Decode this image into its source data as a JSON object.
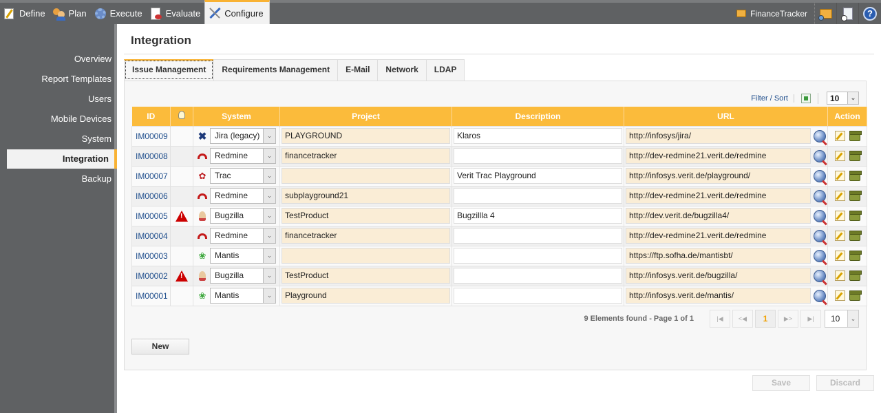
{
  "topnav": {
    "items": [
      {
        "label": "Define",
        "icon": "notepad-icon"
      },
      {
        "label": "Plan",
        "icon": "people-icon"
      },
      {
        "label": "Execute",
        "icon": "gear-icon"
      },
      {
        "label": "Evaluate",
        "icon": "report-chart-icon"
      },
      {
        "label": "Configure",
        "icon": "tools-icon",
        "active": true
      }
    ],
    "project": "FinanceTracker"
  },
  "sidebar": {
    "items": [
      {
        "label": "Overview"
      },
      {
        "label": "Report Templates"
      },
      {
        "label": "Users"
      },
      {
        "label": "Mobile Devices"
      },
      {
        "label": "System"
      },
      {
        "label": "Integration",
        "active": true
      },
      {
        "label": "Backup"
      }
    ]
  },
  "page": {
    "title": "Integration"
  },
  "tabs": [
    {
      "label": "Issue Management",
      "active": true
    },
    {
      "label": "Requirements Management"
    },
    {
      "label": "E-Mail"
    },
    {
      "label": "Network"
    },
    {
      "label": "LDAP"
    }
  ],
  "toolbar": {
    "filter_sort": "Filter / Sort",
    "page_size": "10"
  },
  "table": {
    "headers": {
      "id": "ID",
      "system": "System",
      "project": "Project",
      "description": "Description",
      "url": "URL",
      "action": "Action"
    },
    "rows": [
      {
        "id": "IM00009",
        "warning": false,
        "system": "Jira (legacy)",
        "system_icon": "jira-icon",
        "project": "PLAYGROUND",
        "description": "Klaros",
        "url": "http://infosys/jira/"
      },
      {
        "id": "IM00008",
        "warning": false,
        "system": "Redmine",
        "system_icon": "redmine-icon",
        "project": "financetracker",
        "description": "",
        "url": "http://dev-redmine21.verit.de/redmine"
      },
      {
        "id": "IM00007",
        "warning": false,
        "system": "Trac",
        "system_icon": "trac-icon",
        "project": "",
        "description": "Verit Trac Playground",
        "url": "http://infosys.verit.de/playground/"
      },
      {
        "id": "IM00006",
        "warning": false,
        "system": "Redmine",
        "system_icon": "redmine-icon",
        "project": "subplayground21",
        "description": "",
        "url": "http://dev-redmine21.verit.de/redmine"
      },
      {
        "id": "IM00005",
        "warning": true,
        "system": "Bugzilla",
        "system_icon": "bugzilla-icon",
        "project": "TestProduct",
        "description": "Bugzillla 4",
        "url": "http://dev.verit.de/bugzilla4/"
      },
      {
        "id": "IM00004",
        "warning": false,
        "system": "Redmine",
        "system_icon": "redmine-icon",
        "project": "financetracker",
        "description": "",
        "url": "http://dev-redmine21.verit.de/redmine"
      },
      {
        "id": "IM00003",
        "warning": false,
        "system": "Mantis",
        "system_icon": "mantis-icon",
        "project": "",
        "description": "",
        "url": "https://ftp.sofha.de/mantisbt/"
      },
      {
        "id": "IM00002",
        "warning": true,
        "system": "Bugzilla",
        "system_icon": "bugzilla-icon",
        "project": "TestProduct",
        "description": "",
        "url": "http://infosys.verit.de/bugzilla/"
      },
      {
        "id": "IM00001",
        "warning": false,
        "system": "Mantis",
        "system_icon": "mantis-icon",
        "project": "Playground",
        "description": "",
        "url": "http://infosys.verit.de/mantis/"
      }
    ]
  },
  "pager": {
    "info": "9 Elements found - Page 1 of 1",
    "current_page": "1",
    "page_size": "10"
  },
  "buttons": {
    "new": "New",
    "save": "Save",
    "discard": "Discard"
  }
}
